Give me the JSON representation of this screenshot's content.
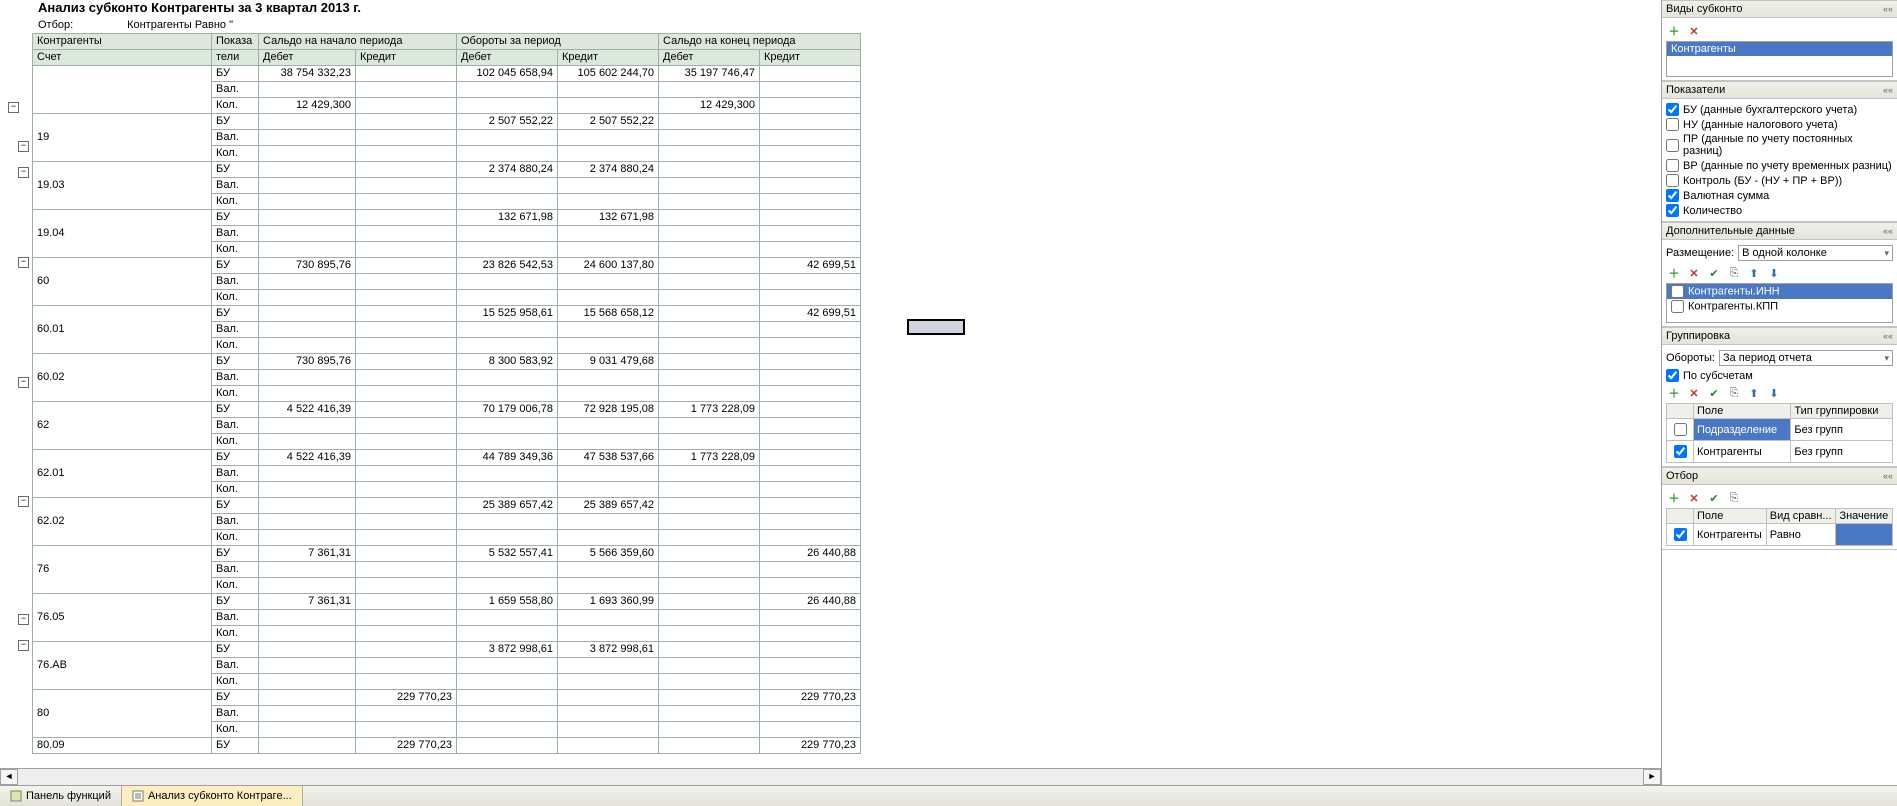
{
  "title": "Анализ субконто Контрагенты за 3 квартал 2013 г.",
  "filter_label": "Отбор:",
  "filter_value": "Контрагенты Равно \"",
  "headers": {
    "c0": "Контрагенты",
    "c0b": "Счет",
    "c1": "Показа",
    "c1b": "тели",
    "g_begin": "Сальдо на начало периода",
    "g_turn": "Обороты за период",
    "g_end": "Сальдо на конец периода",
    "debit": "Дебет",
    "credit": "Кредит"
  },
  "indicators": [
    "БУ",
    "Вал.",
    "Кол."
  ],
  "rows": [
    {
      "acct": "",
      "vals": {
        "bd": "38 754 332,23",
        "td": "102 045 658,94",
        "tc": "105 602 244,70",
        "ed": "35 197 746,47"
      },
      "kolbd": "12 429,300",
      "koled": "12 429,300"
    },
    {
      "acct": "19",
      "vals": {
        "td": "2 507 552,22",
        "tc": "2 507 552,22"
      }
    },
    {
      "acct": "19.03",
      "vals": {
        "td": "2 374 880,24",
        "tc": "2 374 880,24"
      }
    },
    {
      "acct": "19.04",
      "vals": {
        "td": "132 671,98",
        "tc": "132 671,98"
      }
    },
    {
      "acct": "60",
      "vals": {
        "bd": "730 895,76",
        "td": "23 826 542,53",
        "tc": "24 600 137,80",
        "ec": "42 699,51"
      }
    },
    {
      "acct": "60.01",
      "vals": {
        "td": "15 525 958,61",
        "tc": "15 568 658,12",
        "ec": "42 699,51"
      }
    },
    {
      "acct": "60.02",
      "vals": {
        "bd": "730 895,76",
        "td": "8 300 583,92",
        "tc": "9 031 479,68"
      }
    },
    {
      "acct": "62",
      "vals": {
        "bd": "4 522 416,39",
        "td": "70 179 006,78",
        "tc": "72 928 195,08",
        "ed": "1 773 228,09"
      }
    },
    {
      "acct": "62.01",
      "vals": {
        "bd": "4 522 416,39",
        "td": "44 789 349,36",
        "tc": "47 538 537,66",
        "ed": "1 773 228,09"
      }
    },
    {
      "acct": "62.02",
      "vals": {
        "td": "25 389 657,42",
        "tc": "25 389 657,42"
      }
    },
    {
      "acct": "76",
      "vals": {
        "bd": "7 361,31",
        "td": "5 532 557,41",
        "tc": "5 566 359,60",
        "ec": "26 440,88"
      }
    },
    {
      "acct": "76.05",
      "vals": {
        "bd": "7 361,31",
        "td": "1 659 558,80",
        "tc": "1 693 360,99",
        "ec": "26 440,88"
      }
    },
    {
      "acct": "76.АВ",
      "vals": {
        "td": "3 872 998,61",
        "tc": "3 872 998,61"
      }
    },
    {
      "acct": "80",
      "vals": {
        "bc": "229 770,23",
        "ec": "229 770,23"
      }
    },
    {
      "acct": "80.09",
      "vals": {
        "bc": "229 770,23",
        "ec": "229 770,23"
      },
      "single": true
    }
  ],
  "toggles": [
    69,
    108,
    134,
    224,
    344,
    463,
    581,
    607
  ],
  "side": {
    "vidy": {
      "title": "Виды субконто",
      "item": "Контрагенты"
    },
    "pokaz": {
      "title": "Показатели",
      "items": [
        {
          "label": "БУ (данные бухгалтерского учета)",
          "on": true
        },
        {
          "label": "НУ (данные налогового учета)",
          "on": false
        },
        {
          "label": "ПР (данные по учету постоянных разниц)",
          "on": false
        },
        {
          "label": "ВР (данные по учету временных разниц)",
          "on": false
        },
        {
          "label": "Контроль (БУ - (НУ + ПР + ВР))",
          "on": false
        },
        {
          "label": "Валютная сумма",
          "on": true
        },
        {
          "label": "Количество",
          "on": true
        }
      ]
    },
    "dop": {
      "title": "Дополнительные данные",
      "placement_label": "Размещение:",
      "placement_value": "В одной колонке",
      "items": [
        {
          "label": "Контрагенты.ИНН",
          "on": false,
          "sel": true
        },
        {
          "label": "Контрагенты.КПП",
          "on": false
        }
      ]
    },
    "group": {
      "title": "Группировка",
      "turnover_label": "Обороты:",
      "turnover_value": "За период отчета",
      "by_sub_label": "По субсчетам",
      "cols": {
        "field": "Поле",
        "type": "Тип группировки"
      },
      "rows": [
        {
          "on": false,
          "field": "Подразделение",
          "type": "Без групп",
          "sel": true
        },
        {
          "on": true,
          "field": "Контрагенты",
          "type": "Без групп"
        }
      ]
    },
    "otbor": {
      "title": "Отбор",
      "cols": {
        "field": "Поле",
        "cmp": "Вид сравн...",
        "val": "Значение"
      },
      "rows": [
        {
          "on": true,
          "field": "Контрагенты",
          "cmp": "Равно",
          "val": ""
        }
      ]
    }
  },
  "taskbar": {
    "t1": "Панель функций",
    "t2": "Анализ субконто Контраге..."
  }
}
